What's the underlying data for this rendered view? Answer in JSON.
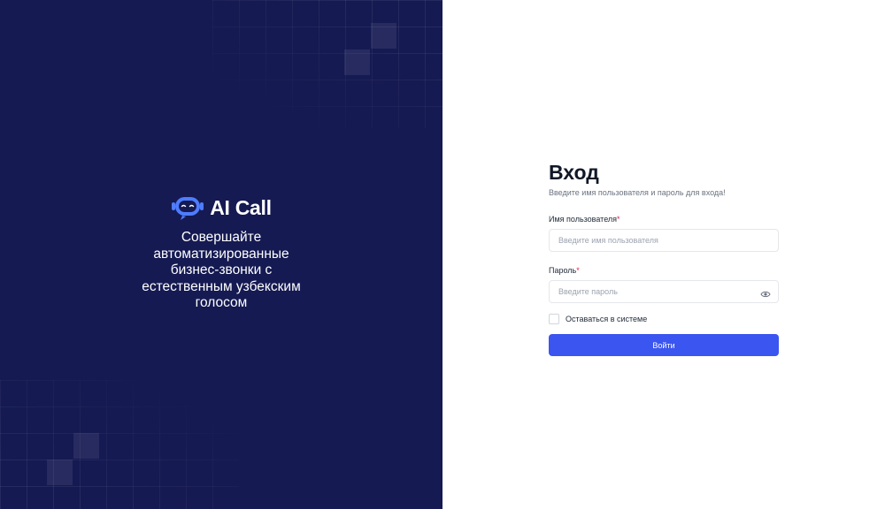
{
  "brand": {
    "name": "AI Call",
    "tagline": "Совершайте автоматизированные бизнес-звонки с естественным узбекским голосом",
    "accent_color": "#4f7cff",
    "panel_color": "#151a52"
  },
  "login": {
    "title": "Вход",
    "subtitle": "Введите имя пользователя и пароль для входа!",
    "username_label": "Имя пользователя",
    "username_placeholder": "Введите имя пользователя",
    "password_label": "Пароль",
    "password_placeholder": "Введите пароль",
    "required_mark": "*",
    "remember_label": "Оставаться в системе",
    "submit_label": "Войти",
    "button_color": "#3b55f0"
  },
  "icons": {
    "logo": "robot-head-icon",
    "password_toggle": "eye-icon"
  }
}
